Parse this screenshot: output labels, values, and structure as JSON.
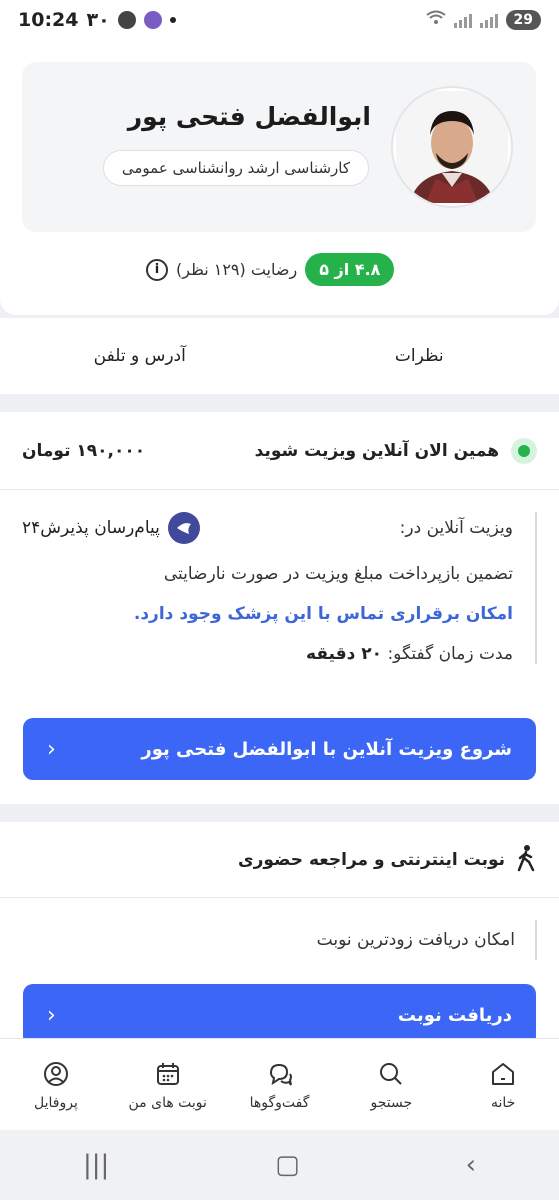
{
  "status_bar": {
    "time": "10:24",
    "left_extra": "۳۰",
    "battery": "29"
  },
  "doctor": {
    "name": "ابوالفضل فتحی پور",
    "title": "کارشناسی ارشد روانشناسی عمومی",
    "rating_badge": "۴.۸ از ۵",
    "rating_text": "رضایت (۱۲۹ نظر)",
    "info_icon": "info-icon"
  },
  "tabs": [
    {
      "label": "نظرات"
    },
    {
      "label": "آدرس و تلفن"
    }
  ],
  "online_visit": {
    "title": "همین الان آنلاین ویزیت شوید",
    "price": "۱۹۰,۰۰۰ تومان",
    "visit_in_label": "ویزیت آنلاین در:",
    "platform": "پیام‌رسان پذیرش۲۴",
    "guarantee": "تضمین بازپرداخت مبلغ ویزیت در صورت نارضایتی",
    "call_possible": "امکان برقراری تماس با این پزشک وجود دارد.",
    "duration_label": "مدت زمان گفتگو:",
    "duration_value": "۲۰ دقیقه",
    "start_button": "شروع ویزیت آنلاین با ابوالفضل فتحی پور"
  },
  "appointment": {
    "title": "نوبت اینترنتی و مراجعه حضوری",
    "earliest": "امکان دریافت زودترین نوبت",
    "get_button": "دریافت نوبت"
  },
  "bottom_nav": [
    {
      "label": "خانه",
      "icon": "home-icon"
    },
    {
      "label": "جستجو",
      "icon": "search-icon"
    },
    {
      "label": "گفت‌وگوها",
      "icon": "chat-icon"
    },
    {
      "label": "نوبت های من",
      "icon": "calendar-icon"
    },
    {
      "label": "پروفایل",
      "icon": "profile-icon"
    }
  ],
  "colors": {
    "accent_blue": "#3c66f5",
    "rating_green": "#26b24b",
    "highlight_blue": "#3d66d8"
  }
}
